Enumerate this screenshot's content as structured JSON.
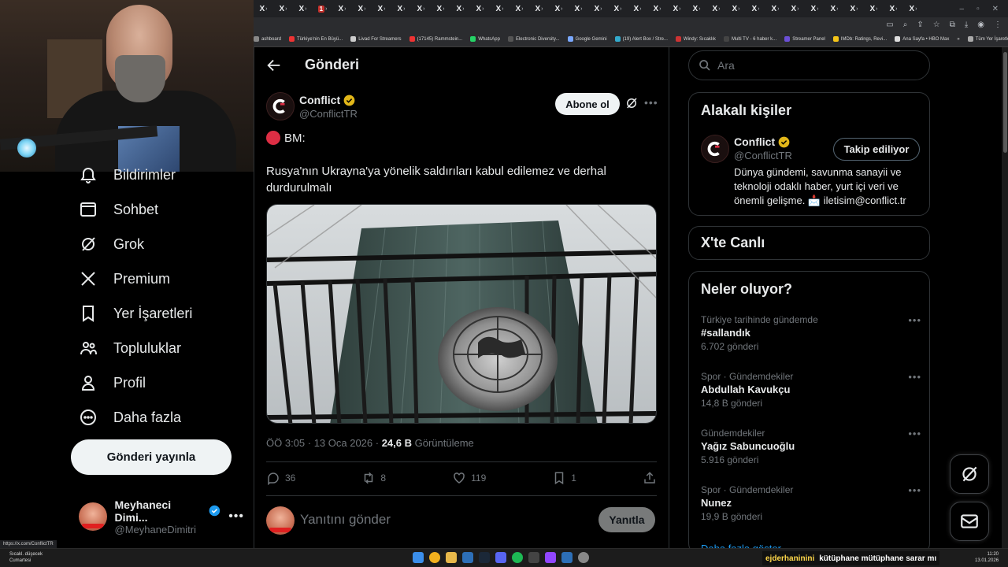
{
  "browser": {
    "tab_icon": "x-logo",
    "youtube_tab_badge": "1",
    "status_url": "https://x.com/ConflictTR",
    "bookmarks": [
      {
        "label": "ashboard",
        "color": "#888"
      },
      {
        "label": "Türkiye'nin En Büyü...",
        "color": "#e33"
      },
      {
        "label": "Livad For Streamers",
        "color": "#ccc"
      },
      {
        "label": "(17145) Rammstein...",
        "color": "#e33"
      },
      {
        "label": "WhatsApp",
        "color": "#25d366"
      },
      {
        "label": "Electronic Diversity...",
        "color": "#555"
      },
      {
        "label": "Google Gemini",
        "color": "#7aa8ff"
      },
      {
        "label": "(19) Alert Box / Stre...",
        "color": "#3ac"
      },
      {
        "label": "Windy: Sıcaklık",
        "color": "#c33"
      },
      {
        "label": "Multi TV - 6 haber k...",
        "color": "#444"
      },
      {
        "label": "Streamer Panel",
        "color": "#6b4fd6"
      },
      {
        "label": "IMDb: Ratings, Revi...",
        "color": "#f5c518"
      },
      {
        "label": "Ana Sayfa • HBO Max",
        "color": "#ddd"
      },
      {
        "label": "»",
        "color": ""
      },
      {
        "label": "Tüm Yer İşaretleri",
        "color": "#aaa"
      }
    ]
  },
  "nav": {
    "items": [
      {
        "label": "Bildirimler",
        "icon": "bell-icon"
      },
      {
        "label": "Sohbet",
        "icon": "mail-icon"
      },
      {
        "label": "Grok",
        "icon": "grok-icon"
      },
      {
        "label": "Premium",
        "icon": "x-icon"
      },
      {
        "label": "Yer İşaretleri",
        "icon": "bookmark-icon"
      },
      {
        "label": "Topluluklar",
        "icon": "people-icon"
      },
      {
        "label": "Profil",
        "icon": "person-icon"
      },
      {
        "label": "Daha fazla",
        "icon": "more-circle-icon"
      }
    ],
    "post_button": "Gönderi yayınla",
    "account": {
      "name": "Meyhaneci Dimi...",
      "handle": "@MeyhaneDimitri"
    }
  },
  "main": {
    "title": "Gönderi",
    "tweet": {
      "author_name": "Conflict",
      "author_handle": "@ConflictTR",
      "follow_label": "Abone ol",
      "line1": "BM:",
      "text": "Rusya'nın Ukrayna'ya yönelik saldırıları kabul edilemez ve derhal durdurulmalı",
      "time": "ÖÖ 3:05 · 13 Oca 2026 · ",
      "views": "24,6 B",
      "views_label": " Görüntüleme",
      "replies": "36",
      "retweets": "8",
      "likes": "119",
      "bookmarks": "1"
    },
    "reply": {
      "placeholder": "Yanıtını gönder",
      "button": "Yanıtla"
    }
  },
  "sidebar": {
    "search_placeholder": "Ara",
    "related_title": "Alakalı kişiler",
    "related": {
      "name": "Conflict",
      "handle": "@ConflictTR",
      "follow_label": "Takip ediliyor",
      "bio": "Dünya gündemi, savunma sanayii ve teknoloji odaklı haber, yurt içi veri ve önemli gelişme. 📩 iletisim@conflict.tr"
    },
    "live_title": "X'te Canlı",
    "trends_title": "Neler oluyor?",
    "trends": [
      {
        "category": "Türkiye tarihinde gündemde",
        "name": "#sallandık",
        "count": "6.702 gönderi"
      },
      {
        "category": "Spor · Gündemdekiler",
        "name": "Abdullah Kavukçu",
        "count": "14,8 B gönderi"
      },
      {
        "category": "Gündemdekiler",
        "name": "Yağız Sabuncuoğlu",
        "count": "5.916 gönderi"
      },
      {
        "category": "Spor · Gündemdekiler",
        "name": "Nunez",
        "count": "19,9 B gönderi"
      }
    ],
    "show_more": "Daha fazla göster"
  },
  "taskbar": {
    "weather_line1": "Sıcakl. düşecek",
    "weather_line2": "Cumartesi",
    "chat_user": "ejderhaninini",
    "chat_message": "kütüphane mütüphane sarar mı",
    "time": "11:20",
    "date": "13.01.2026"
  },
  "colors": {
    "background": "#000000",
    "text": "#e7e9ea",
    "muted": "#71767b",
    "border": "#2f3336",
    "link": "#1d9bf0",
    "verified": "#e2b719",
    "accent_red": "#dd2e44"
  }
}
